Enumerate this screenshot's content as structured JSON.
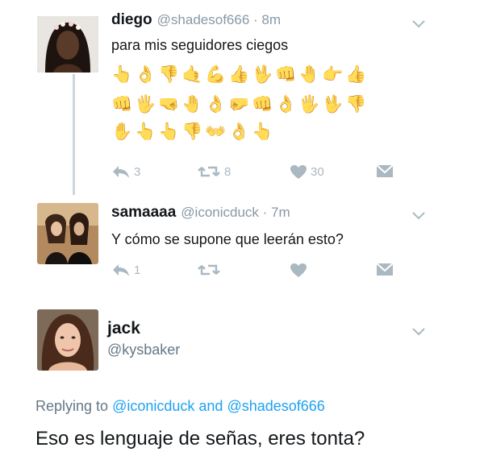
{
  "tweet1": {
    "name": "diego",
    "handle": "@shadesof666 · 8m",
    "text": "para mis seguidores ciegos",
    "emoji_rows": [
      [
        "👆",
        "👌",
        "👎",
        "🤙",
        "💪",
        "👍",
        "🖖",
        "👊",
        "🤚",
        "👉",
        "👍"
      ],
      [
        "👊",
        "🖐",
        "🤜",
        "🤚",
        "👌",
        "🤛",
        "👊",
        "👌",
        "🖐",
        "🖖",
        "👎"
      ],
      [
        "✋",
        "👆",
        "👆",
        "👎",
        "👐",
        "👌",
        "👆"
      ]
    ],
    "reply_count": "3",
    "retweet_count": "8",
    "like_count": "30"
  },
  "tweet2": {
    "name": "samaaaa",
    "handle": "@iconicduck · 7m",
    "text": "Y cómo se supone que leerán esto?",
    "reply_count": "1"
  },
  "tweet3": {
    "name": "jack",
    "handle": "@kysbaker",
    "replying_prefix": "Replying to ",
    "mention1": "@iconicduck",
    "replying_and": " and ",
    "mention2": "@shadesof666",
    "text": "Eso es lenguaje de señas, eres tonta?"
  },
  "colors": {
    "accent": "#1da1f2",
    "muted": "#aab8c2",
    "thread_line": "#ccd6dd"
  }
}
